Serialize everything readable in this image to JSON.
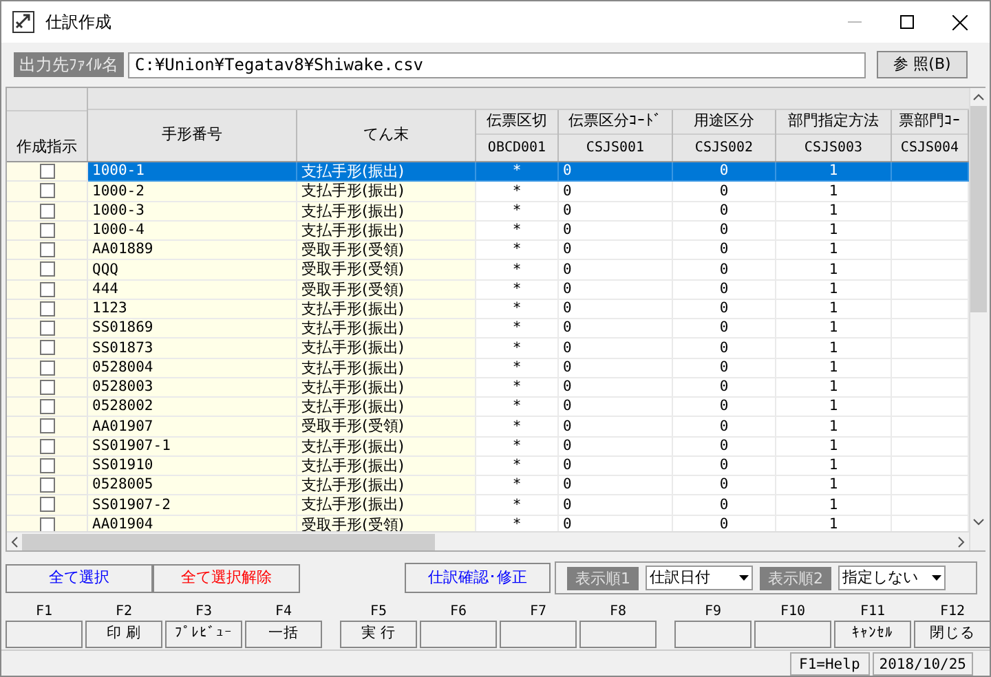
{
  "window": {
    "title": "仕訳作成"
  },
  "output_file": {
    "label": "出力先ﾌｧｲﾙ名",
    "value": "C:¥Union¥Tegatav8¥Shiwake.csv",
    "browse_button": "参 照(B)"
  },
  "table": {
    "row_header_title": "作成指示",
    "columns": [
      {
        "title": "手形番号"
      },
      {
        "title": "てん末"
      },
      {
        "title": "伝票区切",
        "code": "OBCD001"
      },
      {
        "title": "伝票区分ｺｰﾄﾞ",
        "code": "CSJS001"
      },
      {
        "title": "用途区分",
        "code": "CSJS002"
      },
      {
        "title": "部門指定方法",
        "code": "CSJS003"
      },
      {
        "title": "票部門ｺｰ",
        "code": "CSJS004"
      }
    ],
    "rows": [
      {
        "checked": false,
        "selected": true,
        "cells": [
          "1000-1",
          "支払手形(振出)",
          "*",
          "0",
          "0",
          "1",
          ""
        ]
      },
      {
        "checked": false,
        "selected": false,
        "cells": [
          "1000-2",
          "支払手形(振出)",
          "*",
          "0",
          "0",
          "1",
          ""
        ]
      },
      {
        "checked": false,
        "selected": false,
        "cells": [
          "1000-3",
          "支払手形(振出)",
          "*",
          "0",
          "0",
          "1",
          ""
        ]
      },
      {
        "checked": false,
        "selected": false,
        "cells": [
          "1000-4",
          "支払手形(振出)",
          "*",
          "0",
          "0",
          "1",
          ""
        ]
      },
      {
        "checked": false,
        "selected": false,
        "cells": [
          "AA01889",
          "受取手形(受領)",
          "*",
          "0",
          "0",
          "1",
          ""
        ]
      },
      {
        "checked": false,
        "selected": false,
        "cells": [
          "QQQ",
          "受取手形(受領)",
          "*",
          "0",
          "0",
          "1",
          ""
        ]
      },
      {
        "checked": false,
        "selected": false,
        "cells": [
          "444",
          "受取手形(受領)",
          "*",
          "0",
          "0",
          "1",
          ""
        ]
      },
      {
        "checked": false,
        "selected": false,
        "cells": [
          "1123",
          "支払手形(振出)",
          "*",
          "0",
          "0",
          "1",
          ""
        ]
      },
      {
        "checked": false,
        "selected": false,
        "cells": [
          "SS01869",
          "支払手形(振出)",
          "*",
          "0",
          "0",
          "1",
          ""
        ]
      },
      {
        "checked": false,
        "selected": false,
        "cells": [
          "SS01873",
          "支払手形(振出)",
          "*",
          "0",
          "0",
          "1",
          ""
        ]
      },
      {
        "checked": false,
        "selected": false,
        "cells": [
          "0528004",
          "支払手形(振出)",
          "*",
          "0",
          "0",
          "1",
          ""
        ]
      },
      {
        "checked": false,
        "selected": false,
        "cells": [
          "0528003",
          "支払手形(振出)",
          "*",
          "0",
          "0",
          "1",
          ""
        ]
      },
      {
        "checked": false,
        "selected": false,
        "cells": [
          "0528002",
          "支払手形(振出)",
          "*",
          "0",
          "0",
          "1",
          ""
        ]
      },
      {
        "checked": false,
        "selected": false,
        "cells": [
          "AA01907",
          "受取手形(受領)",
          "*",
          "0",
          "0",
          "1",
          ""
        ]
      },
      {
        "checked": false,
        "selected": false,
        "cells": [
          "SS01907-1",
          "支払手形(振出)",
          "*",
          "0",
          "0",
          "1",
          ""
        ]
      },
      {
        "checked": false,
        "selected": false,
        "cells": [
          "SS01910",
          "支払手形(振出)",
          "*",
          "0",
          "0",
          "1",
          ""
        ]
      },
      {
        "checked": false,
        "selected": false,
        "cells": [
          "0528005",
          "支払手形(振出)",
          "*",
          "0",
          "0",
          "1",
          ""
        ]
      },
      {
        "checked": false,
        "selected": false,
        "cells": [
          "SS01907-2",
          "支払手形(振出)",
          "*",
          "0",
          "0",
          "1",
          ""
        ]
      },
      {
        "checked": false,
        "selected": false,
        "cells": [
          "AA01904",
          "受取手形(受領)",
          "*",
          "0",
          "0",
          "1",
          ""
        ]
      }
    ]
  },
  "actions": [
    {
      "label": "全て選択",
      "color": "#0000ff"
    },
    {
      "label": "全て選択解除",
      "color": "#ff0000"
    }
  ],
  "confirm_button": "仕訳確認･修正",
  "sort": [
    {
      "label": "表示順1",
      "value": "仕訳日付"
    },
    {
      "label": "表示順2",
      "value": "指定しない"
    }
  ],
  "function_keys": [
    {
      "key": "F1"
    },
    {
      "key": "F2",
      "label": "印 刷"
    },
    {
      "key": "F3",
      "label": "ﾌﾟﾚﾋﾞｭｰ"
    },
    {
      "key": "F4",
      "label": "一括"
    },
    {
      "key": "F5",
      "label": "実 行"
    },
    {
      "key": "F6"
    },
    {
      "key": "F7"
    },
    {
      "key": "F8"
    },
    {
      "key": "F9"
    },
    {
      "key": "F10"
    },
    {
      "key": "F11",
      "label": "ｷｬﾝｾﾙ"
    },
    {
      "key": "F12",
      "label": "閉じる"
    }
  ],
  "status_bar": {
    "help": "F1=Help",
    "date": "2018/10/25"
  }
}
